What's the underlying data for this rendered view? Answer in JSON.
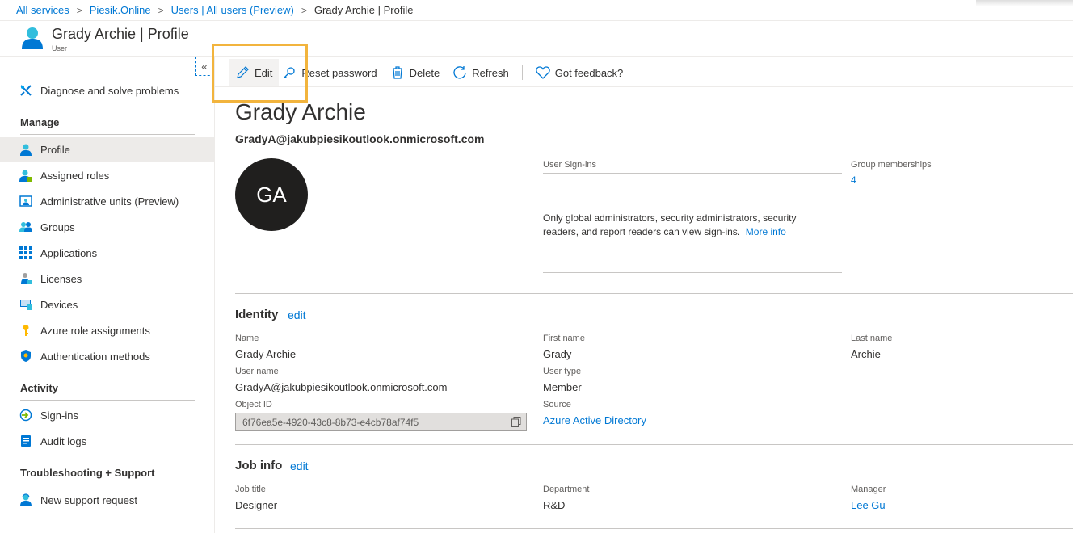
{
  "breadcrumb": [
    "All services",
    "Piesik.Online",
    "Users | All users (Preview)",
    "Grady Archie | Profile"
  ],
  "header": {
    "title": "Grady Archie | Profile",
    "subtitle": "User"
  },
  "sidebar": {
    "collapse_glyph": "«",
    "diagnose": {
      "label": "Diagnose and solve problems",
      "icon": "wrench-icon"
    },
    "sections": {
      "manage": "Manage",
      "activity": "Activity",
      "troubleshooting": "Troubleshooting + Support"
    },
    "manage_items": [
      {
        "label": "Profile",
        "icon": "user-icon"
      },
      {
        "label": "Assigned roles",
        "icon": "assigned-roles-icon"
      },
      {
        "label": "Administrative units (Preview)",
        "icon": "admin-units-icon"
      },
      {
        "label": "Groups",
        "icon": "groups-icon"
      },
      {
        "label": "Applications",
        "icon": "applications-icon"
      },
      {
        "label": "Licenses",
        "icon": "licenses-icon"
      },
      {
        "label": "Devices",
        "icon": "devices-icon"
      },
      {
        "label": "Azure role assignments",
        "icon": "key-icon"
      },
      {
        "label": "Authentication methods",
        "icon": "shield-icon"
      }
    ],
    "activity_items": [
      {
        "label": "Sign-ins",
        "icon": "sign-in-icon"
      },
      {
        "label": "Audit logs",
        "icon": "audit-logs-icon"
      }
    ],
    "support_items": [
      {
        "label": "New support request",
        "icon": "support-icon"
      }
    ],
    "active_item": "Profile"
  },
  "toolbar": {
    "edit": "Edit",
    "reset_password": "Reset password",
    "delete": "Delete",
    "refresh": "Refresh",
    "feedback": "Got feedback?"
  },
  "profile": {
    "display_name": "Grady Archie",
    "upn": "GradyA@jakubpiesikoutlook.onmicrosoft.com",
    "initials": "GA",
    "signins_label": "User Sign-ins",
    "signins_message": "Only global administrators, security administrators, security readers, and report readers can view sign-ins.",
    "more_info": "More info",
    "group_memberships_label": "Group memberships",
    "group_memberships_value": "4"
  },
  "identity": {
    "title": "Identity",
    "edit": "edit",
    "name_label": "Name",
    "name": "Grady Archie",
    "first_name_label": "First name",
    "first_name": "Grady",
    "last_name_label": "Last name",
    "last_name": "Archie",
    "user_name_label": "User name",
    "user_name": "GradyA@jakubpiesikoutlook.onmicrosoft.com",
    "user_type_label": "User type",
    "user_type": "Member",
    "object_id_label": "Object ID",
    "object_id": "6f76ea5e-4920-43c8-8b73-e4cb78af74f5",
    "source_label": "Source",
    "source": "Azure Active Directory"
  },
  "job_info": {
    "title": "Job info",
    "edit": "edit",
    "job_title_label": "Job title",
    "job_title": "Designer",
    "department_label": "Department",
    "department": "R&D",
    "manager_label": "Manager",
    "manager": "Lee Gu"
  },
  "colors": {
    "accent": "#0078d4",
    "highlight": "#f2b43d",
    "avatar": "#201f1e"
  }
}
